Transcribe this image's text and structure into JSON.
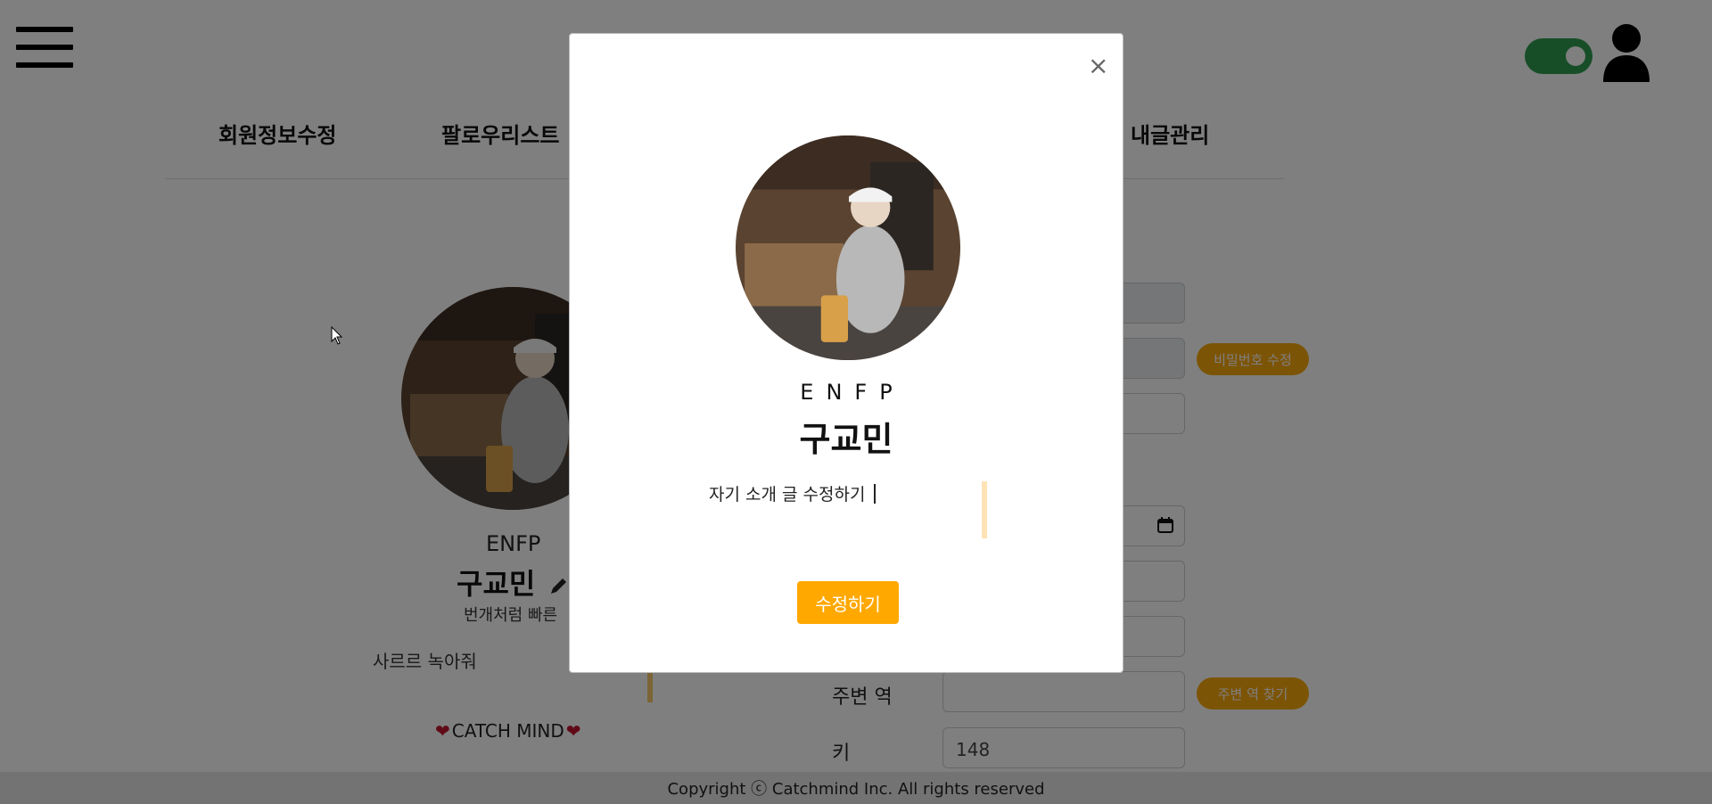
{
  "header": {
    "menu_icon": "hamburger-icon",
    "theme_toggle_on": true,
    "user_icon": "user-icon",
    "accent_color": "#2e9c4e"
  },
  "tabs": [
    {
      "label": "회원정보수정"
    },
    {
      "label": "팔로우리스트"
    },
    {
      "label": "내글관리"
    }
  ],
  "profile": {
    "mbti": "ENFP",
    "name": "구교민",
    "slogan": "번개처럼 빠른",
    "bio": "사르르 녹아줘",
    "brand": "CATCH MIND",
    "edit_icon": "pencil-icon"
  },
  "form": {
    "password_button": "비밀번호 수정",
    "station_label": "주변 역",
    "station_button": "주변 역 찾기",
    "height_label": "키",
    "height_value": "148",
    "calendar_icon": "calendar-icon",
    "button_color": "#f9a80c"
  },
  "footer": {
    "copyright": "Copyright ⓒ Catchmind Inc. All rights reserved"
  },
  "modal": {
    "close_label": "×",
    "mbti": "ENFP",
    "name": "구교민",
    "bio_value": "자기 소개 글 수정하기",
    "submit_label": "수정하기",
    "submit_color": "#ffa800"
  }
}
